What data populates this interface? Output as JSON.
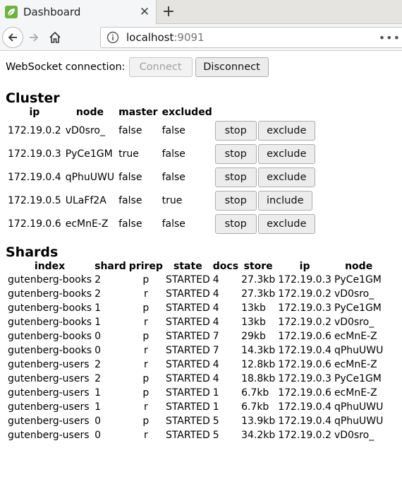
{
  "browser": {
    "tab_title": "Dashboard",
    "url_host": "localhost",
    "url_port": ":9091"
  },
  "websocket": {
    "label": "WebSocket connection:",
    "connect_label": "Connect",
    "disconnect_label": "Disconnect"
  },
  "cluster": {
    "title": "Cluster",
    "headers": [
      "ip",
      "node",
      "master",
      "excluded"
    ],
    "stop_label": "stop",
    "rows": [
      {
        "ip": "172.19.0.2",
        "node": "vD0sro_",
        "master": "false",
        "excluded": "false",
        "action": "exclude"
      },
      {
        "ip": "172.19.0.3",
        "node": "PyCe1GM",
        "master": "true",
        "excluded": "false",
        "action": "exclude"
      },
      {
        "ip": "172.19.0.4",
        "node": "qPhuUWU",
        "master": "false",
        "excluded": "false",
        "action": "exclude"
      },
      {
        "ip": "172.19.0.5",
        "node": "ULaFf2A",
        "master": "false",
        "excluded": "true",
        "action": "include"
      },
      {
        "ip": "172.19.0.6",
        "node": "ecMnE-Z",
        "master": "false",
        "excluded": "false",
        "action": "exclude"
      }
    ]
  },
  "shards": {
    "title": "Shards",
    "headers": [
      "index",
      "shard",
      "prirep",
      "state",
      "docs",
      "store",
      "ip",
      "node"
    ],
    "rows": [
      [
        "gutenberg-books",
        "2",
        "p",
        "STARTED",
        "4",
        "27.3kb",
        "172.19.0.3",
        "PyCe1GM"
      ],
      [
        "gutenberg-books",
        "2",
        "r",
        "STARTED",
        "4",
        "27.3kb",
        "172.19.0.2",
        "vD0sro_"
      ],
      [
        "gutenberg-books",
        "1",
        "p",
        "STARTED",
        "4",
        "13kb",
        "172.19.0.3",
        "PyCe1GM"
      ],
      [
        "gutenberg-books",
        "1",
        "r",
        "STARTED",
        "4",
        "13kb",
        "172.19.0.2",
        "vD0sro_"
      ],
      [
        "gutenberg-books",
        "0",
        "p",
        "STARTED",
        "7",
        "29kb",
        "172.19.0.6",
        "ecMnE-Z"
      ],
      [
        "gutenberg-books",
        "0",
        "r",
        "STARTED",
        "7",
        "14.3kb",
        "172.19.0.4",
        "qPhuUWU"
      ],
      [
        "gutenberg-users",
        "2",
        "r",
        "STARTED",
        "4",
        "12.8kb",
        "172.19.0.6",
        "ecMnE-Z"
      ],
      [
        "gutenberg-users",
        "2",
        "p",
        "STARTED",
        "4",
        "18.8kb",
        "172.19.0.3",
        "PyCe1GM"
      ],
      [
        "gutenberg-users",
        "1",
        "p",
        "STARTED",
        "1",
        "6.7kb",
        "172.19.0.6",
        "ecMnE-Z"
      ],
      [
        "gutenberg-users",
        "1",
        "r",
        "STARTED",
        "1",
        "6.7kb",
        "172.19.0.4",
        "qPhuUWU"
      ],
      [
        "gutenberg-users",
        "0",
        "p",
        "STARTED",
        "5",
        "13.9kb",
        "172.19.0.4",
        "qPhuUWU"
      ],
      [
        "gutenberg-users",
        "0",
        "r",
        "STARTED",
        "5",
        "34.2kb",
        "172.19.0.2",
        "vD0sro_"
      ]
    ]
  },
  "icons": {
    "tab_favicon": "spring-leaf-icon",
    "tab_close": "close-icon",
    "new_tab": "plus-icon",
    "back": "back-arrow-icon",
    "forward": "forward-arrow-icon",
    "home": "home-icon",
    "site_info": "info-icon",
    "page_actions": "more-dots-icon"
  },
  "colors": {
    "spring_green": "#6db33f",
    "button_bg": "#ececec",
    "disabled_text": "#a0a0a0"
  }
}
